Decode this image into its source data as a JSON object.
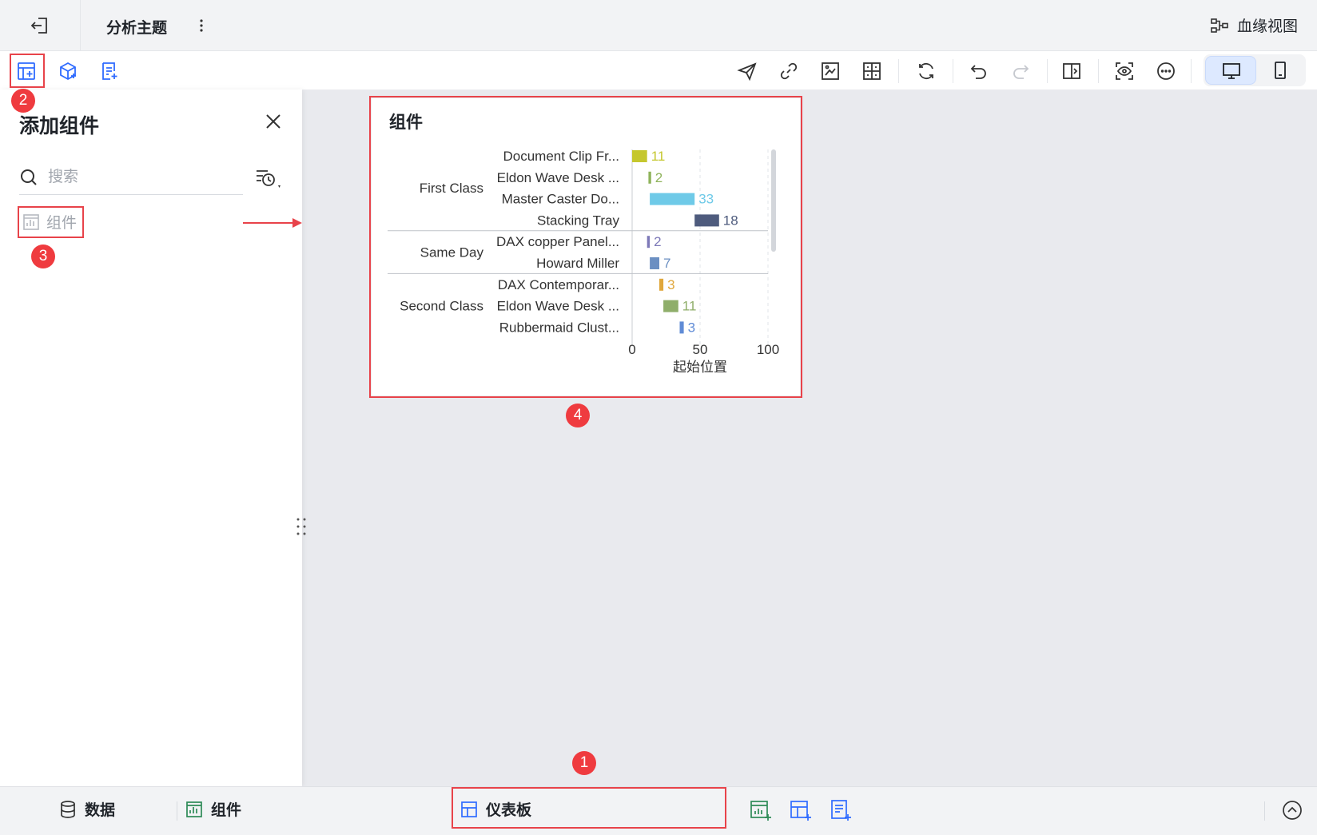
{
  "header": {
    "title": "分析主题",
    "lineage_label": "血缘视图"
  },
  "panel": {
    "title": "添加组件",
    "search_placeholder": "搜索",
    "items": [
      {
        "label": "组件"
      }
    ]
  },
  "annotations": [
    "1",
    "2",
    "3",
    "4"
  ],
  "card": {
    "title": "组件"
  },
  "chart_data": {
    "type": "bar",
    "orientation": "horizontal",
    "groups": [
      {
        "name": "First Class",
        "items": [
          {
            "label": "Document Clip Fr...",
            "start": 0,
            "value": 11,
            "color": "#c5c72e"
          },
          {
            "label": "Eldon Wave Desk ...",
            "start": 12,
            "value": 2,
            "color": "#8fb35b"
          },
          {
            "label": "Master Caster Do...",
            "start": 13,
            "value": 33,
            "color": "#6fcae8"
          },
          {
            "label": "Stacking Tray",
            "start": 46,
            "value": 18,
            "color": "#4e5b7d"
          }
        ]
      },
      {
        "name": "Same Day",
        "items": [
          {
            "label": "DAX copper Panel...",
            "start": 11,
            "value": 2,
            "color": "#7d79b8"
          },
          {
            "label": "Howard Miller",
            "start": 13,
            "value": 7,
            "color": "#6b8fc2"
          }
        ]
      },
      {
        "name": "Second Class",
        "items": [
          {
            "label": "DAX Contemporar...",
            "start": 20,
            "value": 3,
            "color": "#e0a73c"
          },
          {
            "label": "Eldon Wave Desk ...",
            "start": 23,
            "value": 11,
            "color": "#8fae6a"
          },
          {
            "label": "Rubbermaid Clust...",
            "start": 35,
            "value": 3,
            "color": "#5f8bd6"
          }
        ]
      }
    ],
    "xlabel": "起始位置",
    "xticks": [
      "0",
      "50",
      "100"
    ],
    "xlim": [
      0,
      100
    ],
    "grid": true
  },
  "bottom": {
    "data_label": "数据",
    "component_label": "组件",
    "dashboard_label": "仪表板"
  },
  "colors": {
    "accent": "#e8434a",
    "primary": "#2f6bff"
  }
}
